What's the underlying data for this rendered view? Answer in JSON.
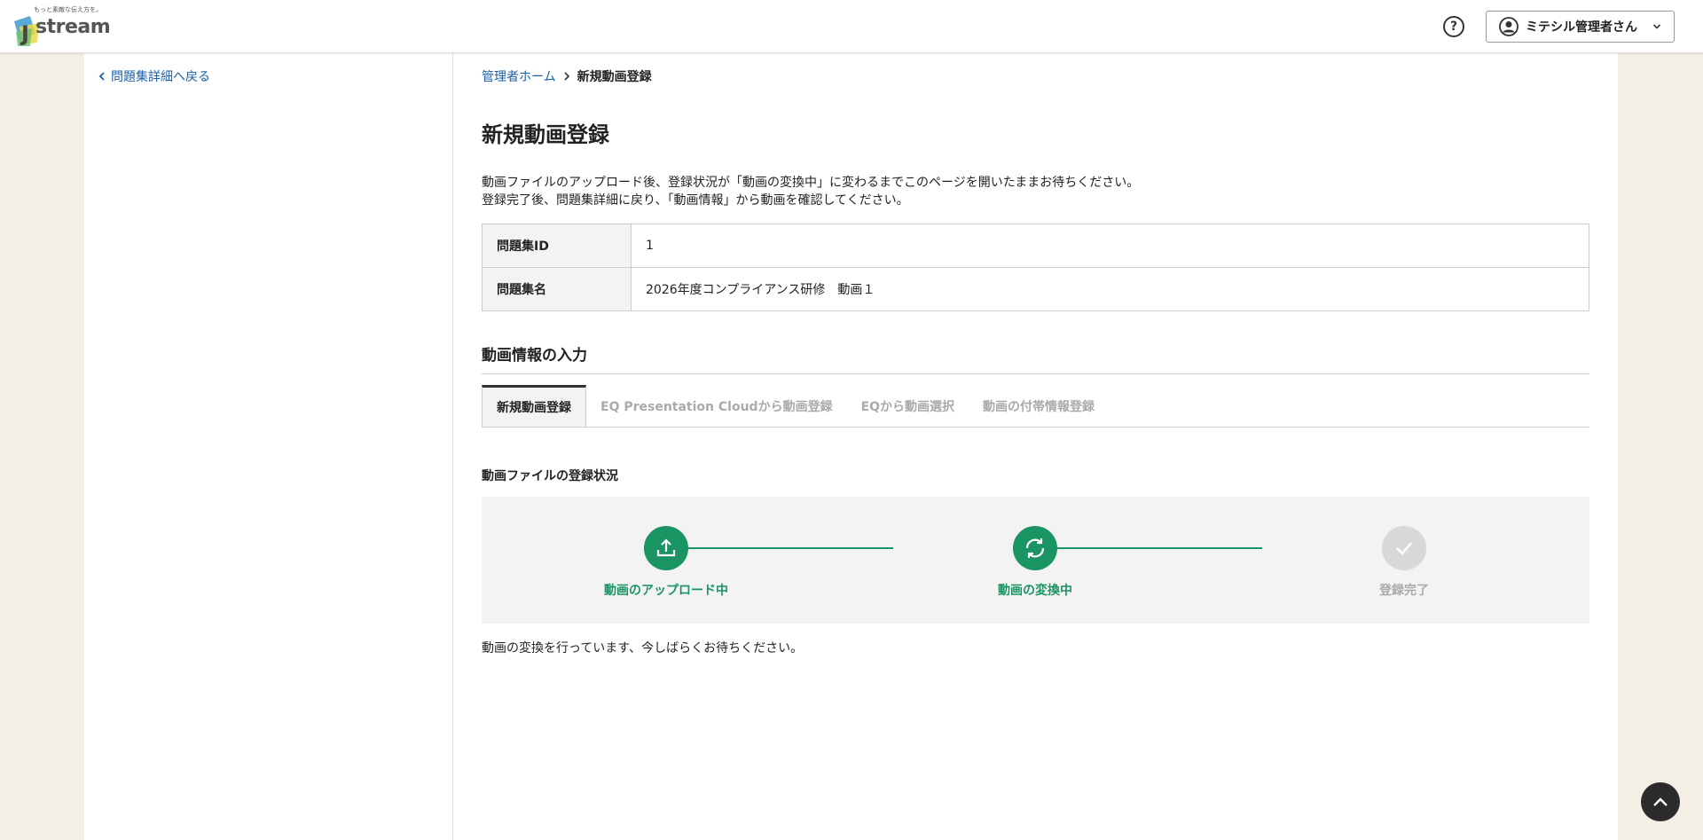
{
  "header": {
    "logo_tagline": "もっと素敵な伝え方を。",
    "logo_text": "stream",
    "help_icon": "question-circle-icon",
    "user_name": "ミテシル管理者さん"
  },
  "sidebar": {
    "back_link": "問題集詳細へ戻る"
  },
  "breadcrumb": {
    "home": "管理者ホーム",
    "current": "新規動画登録"
  },
  "page": {
    "title": "新規動画登録",
    "intro_line1": "動画ファイルのアップロード後、登録状況が「動画の変換中」に変わるまでこのページを開いたままお待ちください。",
    "intro_line2": "登録完了後、問題集詳細に戻り、「動画情報」から動画を確認してください。"
  },
  "info_table": {
    "rows": [
      {
        "label": "問題集ID",
        "value": "1"
      },
      {
        "label": "問題集名",
        "value": "2026年度コンプライアンス研修　動画１"
      }
    ]
  },
  "section": {
    "title": "動画情報の入力"
  },
  "tabs": [
    {
      "label": "新規動画登録",
      "active": true
    },
    {
      "label": "EQ Presentation Cloudから動画登録",
      "active": false
    },
    {
      "label": "EQから動画選択",
      "active": false
    },
    {
      "label": "動画の付帯情報登録",
      "active": false
    }
  ],
  "upload_status": {
    "title": "動画ファイルの登録状況",
    "steps": [
      {
        "label": "動画のアップロード中",
        "state": "done",
        "icon": "upload-icon"
      },
      {
        "label": "動画の変換中",
        "state": "done",
        "icon": "refresh-icon"
      },
      {
        "label": "登録完了",
        "state": "pending",
        "icon": "check-icon"
      }
    ],
    "message": "動画の変換を行っています、今しばらくお待ちください。"
  },
  "colors": {
    "accent_green": "#1a9462",
    "link_blue": "#1a5fa8",
    "page_bg": "#f3efe4"
  }
}
